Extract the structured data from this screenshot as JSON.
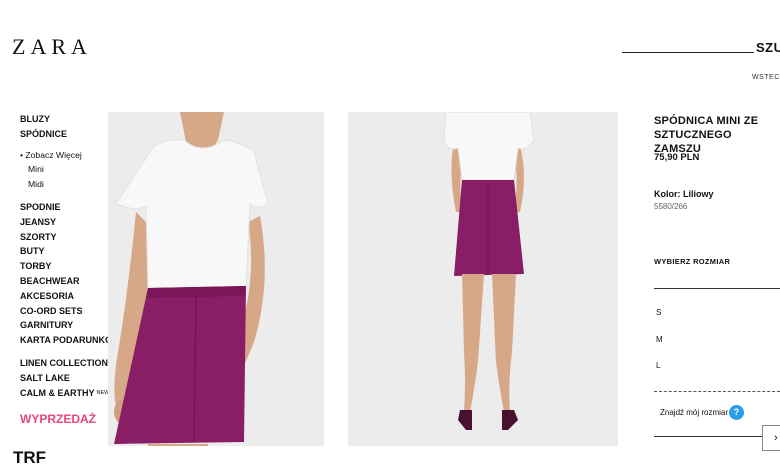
{
  "header": {
    "logo": "ZARA",
    "search_text": "SZU",
    "back_link": "WSTEC"
  },
  "nav": {
    "items": [
      "BLUZY",
      "SPÓDNICE",
      "Zobacz Więcej",
      "Mini",
      "Midi",
      "SPODNIE",
      "JEANSY",
      "SZORTY",
      "BUTY",
      "TORBY",
      "BEACHWEAR",
      "AKCESORIA",
      "CO-ORD SETS",
      "GARNITURY",
      "KARTA PODARUNKOWA",
      "LINEN COLLECTION",
      "SALT LAKE",
      "CALM & EARTHY"
    ],
    "new_badge": "NEW",
    "sale": "WYPRZEDAŻ",
    "trf": "TRF"
  },
  "product": {
    "name": "SPÓDNICA MINI ZE SZTUCZNEGO ZAMSZU",
    "price": "75,90 PLN",
    "color_label": "Kolor: Liliowy",
    "reference": "5580/266",
    "size_title": "WYBIERZ ROZMIAR",
    "sizes": [
      "S",
      "M",
      "L"
    ],
    "find_size": "Znajdź mój rozmiar",
    "help_icon": "?"
  },
  "colors": {
    "skirt": "#8a1e66",
    "top": "#f8f8f8",
    "skin": "#d7a888",
    "sale": "#e5457f",
    "help": "#2a9ee8"
  }
}
